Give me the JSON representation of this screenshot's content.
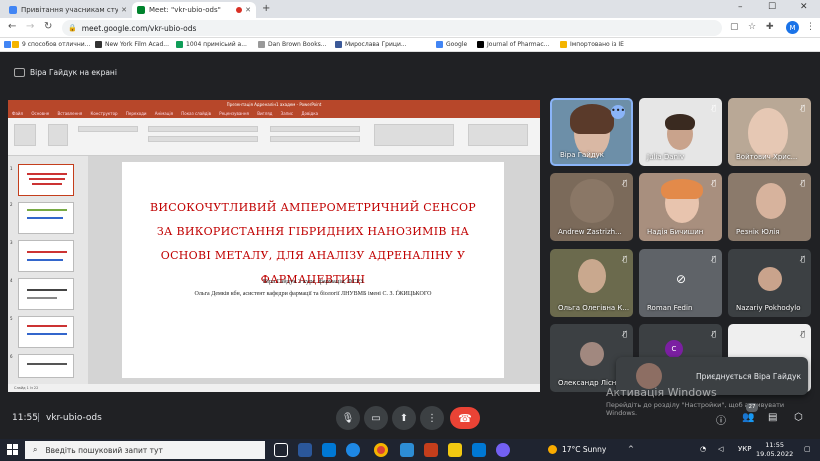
{
  "browser": {
    "tabs": [
      {
        "title": "Привітання учасникам студент",
        "active": false,
        "favicon_color": "#4285f4"
      },
      {
        "title": "Meet: \"vkr-ubio-ods\"",
        "active": true,
        "favicon_color": "#00832d",
        "recording": true
      }
    ],
    "url": "meet.google.com/vkr-ubio-ods",
    "profile_initial": "M",
    "bookmarks": [
      {
        "label": "9 способов отлични...",
        "color": "#f4b400"
      },
      {
        "label": "New York Film Acad...",
        "color": "#333333"
      },
      {
        "label": "1004 примісьий а...",
        "color": "#0f9d58"
      },
      {
        "label": "Dan Brown Books...",
        "color": "#999999"
      },
      {
        "label": "Мирослава Грици...",
        "color": "#3b5998"
      },
      {
        "label": "Google",
        "color": "#4285f4"
      },
      {
        "label": "Journal of Pharmac...",
        "color": "#000000"
      },
      {
        "label": "Імпортовано із IE",
        "color": "#f4b400"
      }
    ]
  },
  "meet": {
    "presenter_banner": "Віра Гайдук на екрані",
    "presentation": {
      "window_title": "Презентація Адреналін1 ахадем - PowerPoint",
      "ribbon_tabs": [
        "Файл",
        "Основне",
        "Вставлення",
        "Конструктор",
        "Переходи",
        "Анімація",
        "Показ слайдів",
        "Рецензування",
        "Вигляд",
        "Запис",
        "Довідка"
      ],
      "status": "Слайд 1 із 22",
      "slide": {
        "title": "ВИСОКОЧУТЛИВИЙ АМПЕРОМЕТРИЧНИЙ СЕНСОР ЗА ВИКОРИСТАННЯ ГІБРИДНИХ НАНОЗИМІВ НА ОСНОВІ МЕТАЛУ, ДЛЯ АНАЛІЗУ АДРЕНАЛІНУ У ФАРМАЦЕВТИЦІ",
        "author": "Віра Гайдук 3 курс. фармація, ФГРЗ",
        "affiliation": "Ольга Демків кбн, асистент кафедри фармації та біології ЛНУВМБ імені С. З. ҐЖИЦЬКОГО"
      },
      "thumbnail_numbers": [
        "1",
        "2",
        "3",
        "4",
        "5",
        "6"
      ]
    },
    "participants": [
      {
        "name": "Віра Гайдук",
        "bg": "#6d8fa8",
        "speaking": true
      },
      {
        "name": "Julia Daniv",
        "bg": "#e6e6e6"
      },
      {
        "name": "Войтович Хрис...",
        "bg": "#b9a896"
      },
      {
        "name": "Andrew Zastrizh...",
        "bg": "#7b6a5a"
      },
      {
        "name": "Надія Бичишин",
        "bg": "#a88f7e"
      },
      {
        "name": "Резнік Юлія",
        "bg": "#8b7a6b"
      },
      {
        "name": "Ольга Олегівна К...",
        "bg": "#6b6a4d"
      },
      {
        "name": "Roman Fedin",
        "bg": "#5f6368",
        "camera_off": true
      },
      {
        "name": "Nazariy Pokhodylo",
        "bg": "#3c4043",
        "avatar": true
      },
      {
        "name": "Олександр Лісн...",
        "bg": "#3c4043",
        "avatar": true
      },
      {
        "name": "",
        "bg": "#3c4043",
        "avatar": true
      },
      {
        "name": "",
        "bg": "#efefef"
      }
    ],
    "toast": "Приєднується Віра Гайдук",
    "meeting_time": "11:55",
    "meeting_code": "vkr-ubio-ods",
    "participant_count": "27"
  },
  "activation": {
    "title": "Активація Windows",
    "line1": "Перейдіть до розділу \"Настройки\", щоб активувати",
    "line2": "Windows."
  },
  "taskbar": {
    "search_placeholder": "Введіть пошуковий запит тут",
    "weather": "17°C Sunny",
    "language": "УКР",
    "time": "11:55",
    "date": "19.05.2022"
  }
}
